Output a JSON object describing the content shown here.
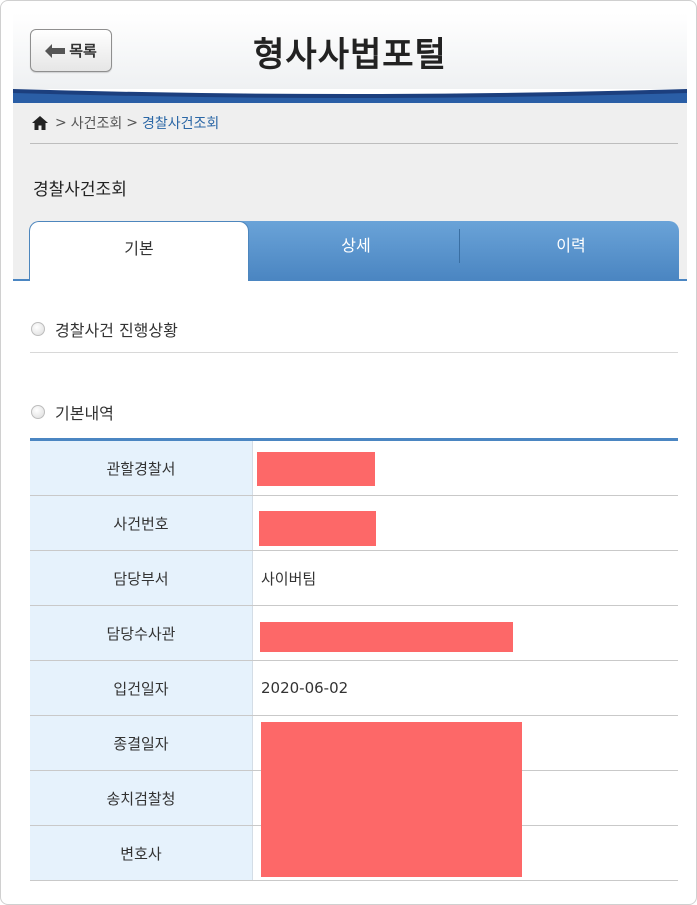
{
  "header": {
    "back_label": "목록",
    "title": "형사사법포털"
  },
  "breadcrumb": {
    "items": [
      "사건조회"
    ],
    "current": "경찰사건조회"
  },
  "page": {
    "title": "경찰사건조회"
  },
  "tabs": [
    {
      "label": "기본",
      "active": true
    },
    {
      "label": "상세",
      "active": false
    },
    {
      "label": "이력",
      "active": false
    }
  ],
  "sections": {
    "progress": "경찰사건 진행상황",
    "basic": "기본내역"
  },
  "table": {
    "rows": [
      {
        "label": "관할경찰서",
        "value": ""
      },
      {
        "label": "사건번호",
        "value": ""
      },
      {
        "label": "담당부서",
        "value": "사이버팀"
      },
      {
        "label": "담당수사관",
        "value": ""
      },
      {
        "label": "입건일자",
        "value": "2020-06-02"
      },
      {
        "label": "종결일자",
        "value": ""
      },
      {
        "label": "송치검찰청",
        "value": ""
      },
      {
        "label": "변호사",
        "value": ""
      }
    ]
  },
  "colors": {
    "accent": "#4b86c2",
    "redaction": "#fd6868",
    "label_bg": "#e6f2fc"
  }
}
